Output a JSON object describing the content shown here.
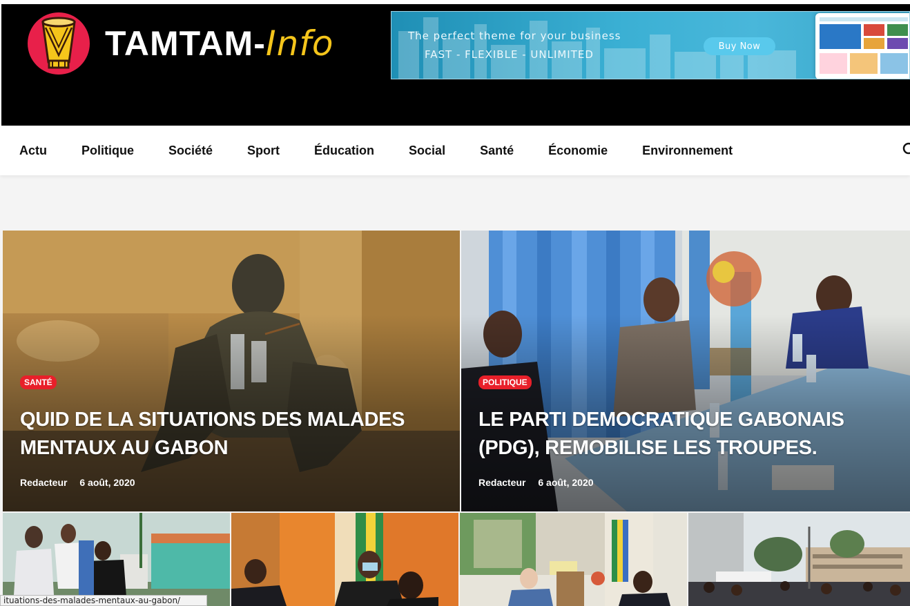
{
  "site": {
    "logo_main": "TAMTAM",
    "logo_dash": "-",
    "logo_accent": "Info",
    "brand_color": "#e8204a",
    "accent_color": "#f5c51b"
  },
  "ad": {
    "line1": "The perfect theme for your business",
    "line2": "FAST - FLEXIBLE - UNLIMITED",
    "button": "Buy Now"
  },
  "nav": {
    "items": [
      "Actu",
      "Politique",
      "Société",
      "Sport",
      "Éducation",
      "Social",
      "Santé",
      "Économie",
      "Environnement"
    ]
  },
  "featured": [
    {
      "category": "SANTÉ",
      "title": "QUID DE LA SITUATIONS DES MALADES MENTAUX AU GABON",
      "author": "Redacteur",
      "date": "6 août, 2020"
    },
    {
      "category": "POLITIQUE",
      "title": "LE PARTI DEMOCRATIQUE GABONAIS (PDG), REMOBILISE LES TROUPES.",
      "author": "Redacteur",
      "date": "6 août, 2020"
    }
  ],
  "status_url": "ituations-des-malades-mentaux-au-gabon/"
}
